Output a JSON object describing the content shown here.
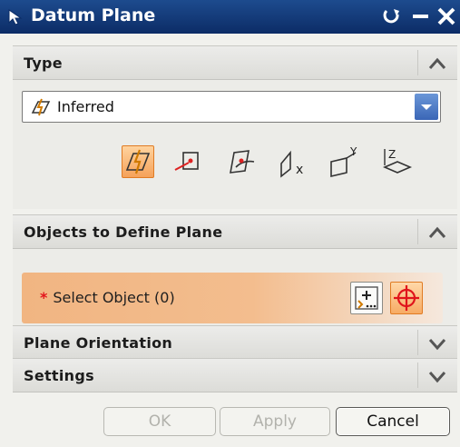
{
  "window": {
    "title": "Datum Plane"
  },
  "sections": {
    "type": {
      "title": "Type",
      "expanded": true,
      "dropdown": {
        "value": "Inferred",
        "icon": "inferred-plane-icon"
      },
      "plane_icons": [
        "inferred-plane-icon",
        "point-and-direction-icon",
        "on-curve-icon",
        "yc-zc-plane-icon",
        "xc-zc-plane-icon",
        "xc-yc-plane-icon"
      ],
      "selected_icon": "inferred-plane-icon"
    },
    "objects": {
      "title": "Objects to Define Plane",
      "expanded": true,
      "select": {
        "label": "Select Object (0)",
        "required_marker": "*"
      }
    },
    "orientation": {
      "title": "Plane Orientation",
      "expanded": false
    },
    "settings": {
      "title": "Settings",
      "expanded": false
    }
  },
  "buttons": {
    "ok": "OK",
    "apply": "Apply",
    "cancel": "Cancel"
  },
  "colors": {
    "titlebar": "#0f3473",
    "highlight": "#f5a25a",
    "required": "#e3141b"
  }
}
